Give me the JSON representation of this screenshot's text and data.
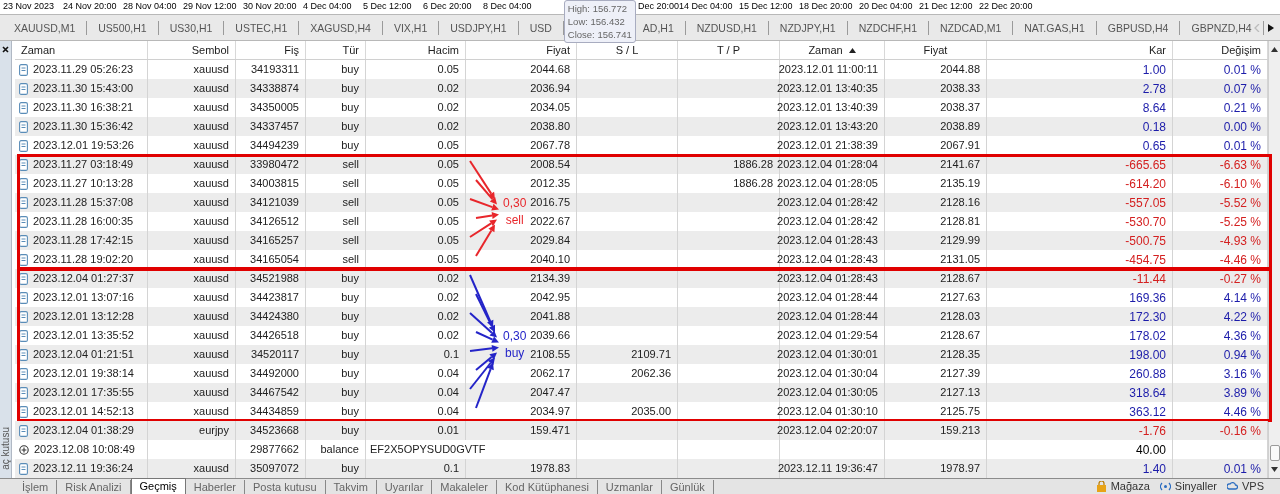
{
  "timeline": [
    {
      "label": "23 Nov 2023"
    },
    {
      "label": "24 Nov 20:00"
    },
    {
      "label": "28 Nov 04:00"
    },
    {
      "label": "29 Nov 12:00"
    },
    {
      "label": "30 Nov 20:00"
    },
    {
      "label": "4 Dec 04:00"
    },
    {
      "label": "5 Dec 12:00"
    },
    {
      "label": "6 Dec 20:00"
    },
    {
      "label": "8 Dec 04:00"
    },
    {
      "label": "Dec 20:00",
      "gap_before": true
    },
    {
      "label": "14 Dec 04:00"
    },
    {
      "label": "15 Dec 12:00"
    },
    {
      "label": "18 Dec 20:00"
    },
    {
      "label": "20 Dec 04:00"
    },
    {
      "label": "21 Dec 12:00"
    },
    {
      "label": "22 Dec 20:00"
    }
  ],
  "tooltip": [
    "High: 156.772",
    "Low: 156.432",
    "Close: 156.741"
  ],
  "chart_tabs": [
    {
      "label": "XAUUSD,M1"
    },
    {
      "label": "US500,H1"
    },
    {
      "label": "US30,H1"
    },
    {
      "label": "USTEC,H1"
    },
    {
      "label": "XAGUSD,H4"
    },
    {
      "label": "VIX,H1"
    },
    {
      "label": "USDJPY,H1"
    },
    {
      "label": "USD"
    },
    {
      "label": "AD,H1",
      "gap_before": true
    },
    {
      "label": "NZDUSD,H1"
    },
    {
      "label": "NZDJPY,H1"
    },
    {
      "label": "NZDCHF,H1"
    },
    {
      "label": "NZDCAD,M1"
    },
    {
      "label": "NAT.GAS,H1"
    },
    {
      "label": "GBPUSD,H4"
    },
    {
      "label": "GBPNZD,H4"
    }
  ],
  "table": {
    "columns": [
      {
        "label": "Zaman",
        "sorted": false
      },
      {
        "label": "Sembol",
        "sorted": false
      },
      {
        "label": "Fiş",
        "sorted": false
      },
      {
        "label": "Tür",
        "sorted": false
      },
      {
        "label": "Hacim",
        "sorted": false
      },
      {
        "label": "Fiyat",
        "sorted": false
      },
      {
        "label": "S / L",
        "sorted": false
      },
      {
        "label": "T / P",
        "sorted": false
      },
      {
        "label": "Zaman",
        "sorted": true
      },
      {
        "label": "Fiyat",
        "sorted": false
      },
      {
        "label": "Kar",
        "sorted": false
      },
      {
        "label": "Değişim",
        "sorted": false
      }
    ],
    "groups": [
      {
        "highlighted": false,
        "rows": [
          {
            "kind": "trade",
            "time": "2023.11.29 05:26:23",
            "symbol": "xauusd",
            "ticket": "34193311",
            "type": "buy",
            "volume": "0.05",
            "price": "2044.68",
            "close_time": "2023.12.01 11:00:11",
            "close_price": "2044.88",
            "profit": "1.00",
            "change": "0.01 %",
            "color": "#1c1caa"
          },
          {
            "kind": "trade",
            "time": "2023.11.30 15:43:00",
            "symbol": "xauusd",
            "ticket": "34338874",
            "type": "buy",
            "volume": "0.02",
            "price": "2036.94",
            "close_time": "2023.12.01 13:40:35",
            "close_price": "2038.33",
            "profit": "2.78",
            "change": "0.07 %",
            "color": "#1c1caa"
          },
          {
            "kind": "trade",
            "time": "2023.11.30 16:38:21",
            "symbol": "xauusd",
            "ticket": "34350005",
            "type": "buy",
            "volume": "0.02",
            "price": "2034.05",
            "close_time": "2023.12.01 13:40:39",
            "close_price": "2038.37",
            "profit": "8.64",
            "change": "0.21 %",
            "color": "#1c1caa"
          },
          {
            "kind": "trade",
            "time": "2023.11.30 15:36:42",
            "symbol": "xauusd",
            "ticket": "34337457",
            "type": "buy",
            "volume": "0.02",
            "price": "2038.80",
            "close_time": "2023.12.01 13:43:20",
            "close_price": "2038.89",
            "profit": "0.18",
            "change": "0.00 %",
            "color": "#1c1caa"
          },
          {
            "kind": "trade",
            "time": "2023.12.01 19:53:26",
            "symbol": "xauusd",
            "ticket": "34494239",
            "type": "buy",
            "volume": "0.05",
            "price": "2067.78",
            "close_time": "2023.12.01 21:38:39",
            "close_price": "2067.91",
            "profit": "0.65",
            "change": "0.01 %",
            "color": "#1c1caa"
          }
        ]
      },
      {
        "highlighted": true,
        "annotation": {
          "lines": [
            "0,30",
            "sell"
          ],
          "color": "#e8262b"
        },
        "rows": [
          {
            "kind": "trade",
            "time": "2023.11.27 03:18:49",
            "symbol": "xauusd",
            "ticket": "33980472",
            "type": "sell",
            "volume": "0.05",
            "price": "2008.54",
            "tp": "1886.28",
            "close_time": "2023.12.04 01:28:04",
            "close_price": "2141.67",
            "profit": "-665.65",
            "change": "-6.63 %",
            "color": "#d42020"
          },
          {
            "kind": "trade",
            "time": "2023.11.27 10:13:28",
            "symbol": "xauusd",
            "ticket": "34003815",
            "type": "sell",
            "volume": "0.05",
            "price": "2012.35",
            "tp": "1886.28",
            "close_time": "2023.12.04 01:28:05",
            "close_price": "2135.19",
            "profit": "-614.20",
            "change": "-6.10 %",
            "color": "#d42020"
          },
          {
            "kind": "trade",
            "time": "2023.11.28 15:37:08",
            "symbol": "xauusd",
            "ticket": "34121039",
            "type": "sell",
            "volume": "0.05",
            "price": "2016.75",
            "close_time": "2023.12.04 01:28:42",
            "close_price": "2128.16",
            "profit": "-557.05",
            "change": "-5.52 %",
            "color": "#d42020"
          },
          {
            "kind": "trade",
            "time": "2023.11.28 16:00:35",
            "symbol": "xauusd",
            "ticket": "34126512",
            "type": "sell",
            "volume": "0.05",
            "price": "2022.67",
            "close_time": "2023.12.04 01:28:42",
            "close_price": "2128.81",
            "profit": "-530.70",
            "change": "-5.25 %",
            "color": "#d42020"
          },
          {
            "kind": "trade",
            "time": "2023.11.28 17:42:15",
            "symbol": "xauusd",
            "ticket": "34165257",
            "type": "sell",
            "volume": "0.05",
            "price": "2029.84",
            "close_time": "2023.12.04 01:28:43",
            "close_price": "2129.99",
            "profit": "-500.75",
            "change": "-4.93 %",
            "color": "#d42020"
          },
          {
            "kind": "trade",
            "time": "2023.11.28 19:02:20",
            "symbol": "xauusd",
            "ticket": "34165054",
            "type": "sell",
            "volume": "0.05",
            "price": "2040.10",
            "close_time": "2023.12.04 01:28:43",
            "close_price": "2131.05",
            "profit": "-454.75",
            "change": "-4.46 %",
            "color": "#d42020"
          }
        ]
      },
      {
        "highlighted": true,
        "annotation": {
          "lines": [
            "0,30",
            "buy"
          ],
          "color": "#2424c8"
        },
        "rows": [
          {
            "kind": "trade",
            "time": "2023.12.04 01:27:37",
            "symbol": "xauusd",
            "ticket": "34521988",
            "type": "buy",
            "volume": "0.02",
            "price": "2134.39",
            "close_time": "2023.12.04 01:28:43",
            "close_price": "2128.67",
            "profit": "-11.44",
            "change": "-0.27 %",
            "color": "#d42020"
          },
          {
            "kind": "trade",
            "time": "2023.12.01 13:07:16",
            "symbol": "xauusd",
            "ticket": "34423817",
            "type": "buy",
            "volume": "0.02",
            "price": "2042.95",
            "close_time": "2023.12.04 01:28:44",
            "close_price": "2127.63",
            "profit": "169.36",
            "change": "4.14 %",
            "color": "#1c1caa"
          },
          {
            "kind": "trade",
            "time": "2023.12.01 13:12:28",
            "symbol": "xauusd",
            "ticket": "34424380",
            "type": "buy",
            "volume": "0.02",
            "price": "2041.88",
            "close_time": "2023.12.04 01:28:44",
            "close_price": "2128.03",
            "profit": "172.30",
            "change": "4.22 %",
            "color": "#1c1caa"
          },
          {
            "kind": "trade",
            "time": "2023.12.01 13:35:52",
            "symbol": "xauusd",
            "ticket": "34426518",
            "type": "buy",
            "volume": "0.02",
            "price": "2039.66",
            "close_time": "2023.12.04 01:29:54",
            "close_price": "2128.67",
            "profit": "178.02",
            "change": "4.36 %",
            "color": "#1c1caa"
          },
          {
            "kind": "trade",
            "time": "2023.12.04 01:21:51",
            "symbol": "xauusd",
            "ticket": "34520117",
            "type": "buy",
            "volume": "0.1",
            "price": "2108.55",
            "sl": "2109.71",
            "close_time": "2023.12.04 01:30:01",
            "close_price": "2128.35",
            "profit": "198.00",
            "change": "0.94 %",
            "color": "#1c1caa"
          },
          {
            "kind": "trade",
            "time": "2023.12.01 19:38:14",
            "symbol": "xauusd",
            "ticket": "34492000",
            "type": "buy",
            "volume": "0.04",
            "price": "2062.17",
            "sl": "2062.36",
            "close_time": "2023.12.04 01:30:04",
            "close_price": "2127.39",
            "profit": "260.88",
            "change": "3.16 %",
            "color": "#1c1caa"
          },
          {
            "kind": "trade",
            "time": "2023.12.01 17:35:55",
            "symbol": "xauusd",
            "ticket": "34467542",
            "type": "buy",
            "volume": "0.04",
            "price": "2047.47",
            "close_time": "2023.12.04 01:30:05",
            "close_price": "2127.13",
            "profit": "318.64",
            "change": "3.89 %",
            "color": "#1c1caa"
          },
          {
            "kind": "trade",
            "time": "2023.12.01 14:52:13",
            "symbol": "xauusd",
            "ticket": "34434859",
            "type": "buy",
            "volume": "0.04",
            "price": "2034.97",
            "sl": "2035.00",
            "close_time": "2023.12.04 01:30:10",
            "close_price": "2125.75",
            "profit": "363.12",
            "change": "4.46 %",
            "color": "#1c1caa"
          }
        ]
      },
      {
        "highlighted": false,
        "rows": [
          {
            "kind": "trade",
            "time": "2023.12.04 01:38:29",
            "symbol": "eurjpy",
            "ticket": "34523668",
            "type": "buy",
            "volume": "0.01",
            "price": "159.471",
            "close_time": "2023.12.04 02:20:07",
            "close_price": "159.213",
            "profit": "-1.76",
            "change": "-0.16 %",
            "color": "#d42020"
          },
          {
            "kind": "balance",
            "time": "2023.12.08 10:08:49",
            "ticket": "29877662",
            "type": "balance",
            "comment": "EF2X5OPYSUD0GVTF",
            "profit": "40.00",
            "color": "#000000"
          },
          {
            "kind": "trade",
            "time": "2023.12.11 19:36:24",
            "symbol": "xauusd",
            "ticket": "35097072",
            "type": "buy",
            "volume": "0.1",
            "price": "1978.83",
            "close_time": "2023.12.11 19:36:47",
            "close_price": "1978.97",
            "profit": "1.40",
            "change": "0.01 %",
            "color": "#1c1caa"
          }
        ]
      }
    ]
  },
  "side_panel": {
    "label": "aç kutusu"
  },
  "bottom_tabs": [
    {
      "label": "İşlem",
      "selected": false
    },
    {
      "label": "Risk Analizi",
      "selected": false
    },
    {
      "label": "Geçmiş",
      "selected": true
    },
    {
      "label": "Haberler",
      "selected": false
    },
    {
      "label": "Posta kutusu",
      "selected": false
    },
    {
      "label": "Takvim",
      "selected": false
    },
    {
      "label": "Uyarılar",
      "selected": false
    },
    {
      "label": "Makaleler",
      "selected": false
    },
    {
      "label": "Kod Kütüphanesi",
      "selected": false
    },
    {
      "label": "Uzmanlar",
      "selected": false
    },
    {
      "label": "Günlük",
      "selected": false
    }
  ],
  "bottom_links": [
    {
      "kind": "store",
      "label": "Mağaza"
    },
    {
      "kind": "signals",
      "label": "Sinyaller"
    },
    {
      "kind": "vps",
      "label": "VPS"
    }
  ]
}
